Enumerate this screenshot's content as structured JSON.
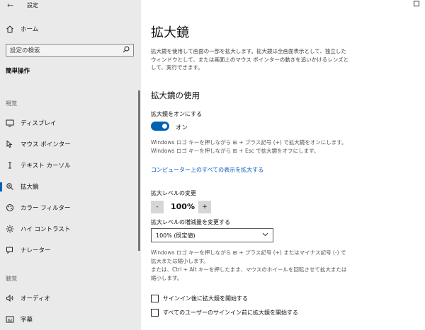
{
  "window": {
    "title": "設定",
    "back_icon": "back-arrow-icon",
    "maximize_icon": "maximize-icon"
  },
  "sidebar": {
    "home": {
      "label": "ホーム",
      "icon": "home-icon"
    },
    "search": {
      "placeholder": "設定の検索",
      "icon": "search-icon"
    },
    "category_title": "簡単操作",
    "section_vision": "視覚",
    "items": [
      {
        "label": "ディスプレイ",
        "icon": "display-icon"
      },
      {
        "label": "マウス ポインター",
        "icon": "mouse-pointer-icon"
      },
      {
        "label": "テキスト カーソル",
        "icon": "text-cursor-icon"
      },
      {
        "label": "拡大鏡",
        "icon": "magnifier-icon",
        "selected": true
      },
      {
        "label": "カラー フィルター",
        "icon": "color-filter-icon"
      },
      {
        "label": "ハイ コントラスト",
        "icon": "high-contrast-icon"
      },
      {
        "label": "ナレーター",
        "icon": "narrator-icon"
      }
    ],
    "section_hearing": "聴覚",
    "hearing_items": [
      {
        "label": "オーディオ",
        "icon": "audio-icon"
      },
      {
        "label": "字幕",
        "icon": "captions-icon"
      }
    ]
  },
  "main": {
    "title": "拡大鏡",
    "description": "拡大鏡を使用して画面の一部を拡大します。拡大鏡は全画面表示として、独立したウィンドウとして、または画面上のマウス ポインターの動きを追いかけるレンズとして、実行できます。",
    "section_title": "拡大鏡の使用",
    "toggle_label": "拡大鏡をオンにする",
    "toggle_state": "オン",
    "toggle_on": true,
    "hint_on": "Windows ロゴ キーを押しながら ⊞ + プラス記号 (+) で拡大鏡をオンにします。",
    "hint_off": "Windows ロゴ キーを押しながら ⊞ + Esc で拡大鏡をオフにします。",
    "link": "コンピューター上のすべての表示を拡大する",
    "zoom_label": "拡大レベルの変更",
    "zoom_minus": "-",
    "zoom_value": "100%",
    "zoom_plus": "+",
    "increment_label": "拡大レベルの増減量を変更する",
    "increment_value": "100% (既定値)",
    "hint_zoom_1": "Windows ロゴ キーを押しながら ⊞ + プラス記号 (+) またはマイナス記号 (-) で拡大または縮小します。",
    "hint_zoom_2": "または、Ctrl + Alt キーを押したまま、マウスのホイールを回転させて拡大または縮小します。",
    "checkbox_1": "サインイン後に拡大鏡を開始する",
    "checkbox_2": "すべてのユーザーのサインイン前に拡大鏡を開始する",
    "checkbox_1_checked": false,
    "checkbox_2_checked": false
  },
  "colors": {
    "accent": "#0063b1",
    "link": "#0a5bbf",
    "sidebar_bg": "#eaeaea"
  }
}
